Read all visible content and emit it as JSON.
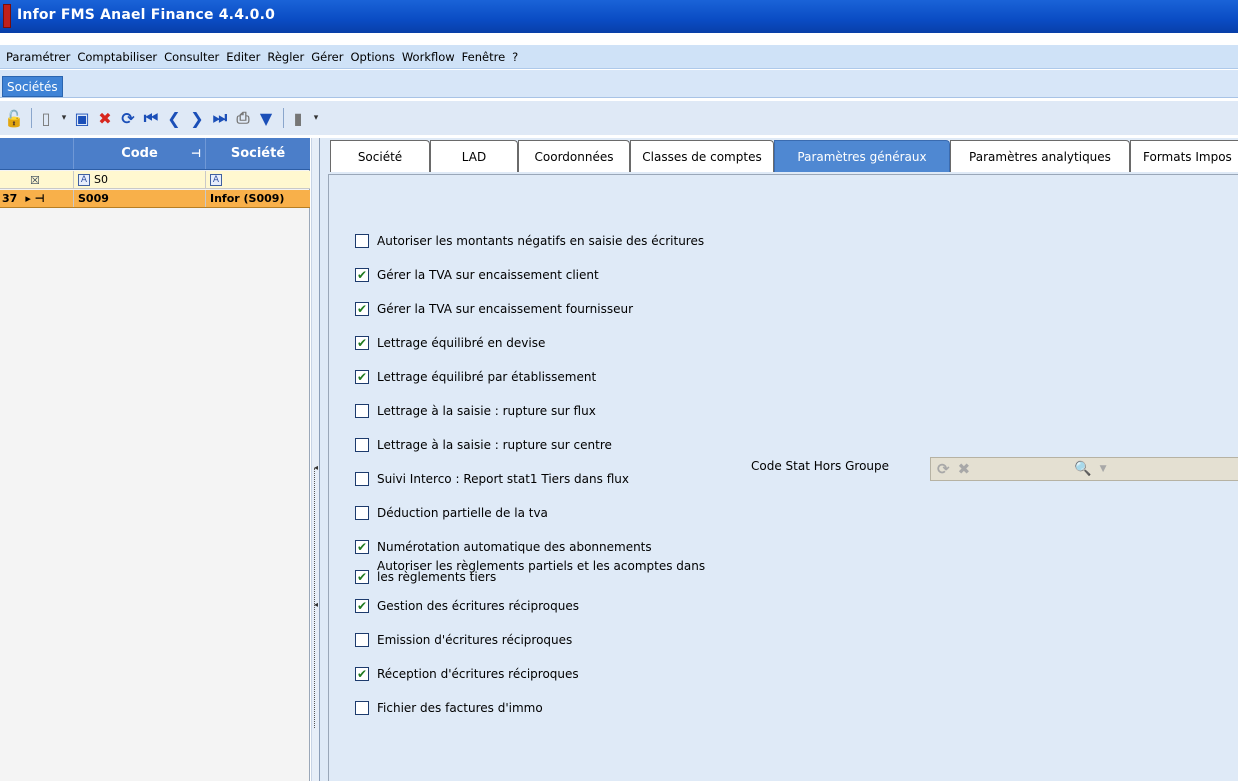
{
  "window": {
    "title": "Infor FMS Anael Finance 4.4.0.0"
  },
  "menubar": [
    "Paramétrer",
    "Comptabiliser",
    "Consulter",
    "Editer",
    "Règler",
    "Gérer",
    "Options",
    "Workflow",
    "Fenêtre",
    "?"
  ],
  "doc_tab": "Sociétés",
  "grid": {
    "columns": [
      "Code",
      "Société"
    ],
    "filter": {
      "code": "S0",
      "societe": ""
    },
    "row": {
      "count": "37",
      "code": "S009",
      "societe": "Infor (S009)"
    }
  },
  "tabs": [
    "Société",
    "LAD",
    "Coordonnées",
    "Classes de comptes",
    "Paramètres généraux",
    "Paramètres analytiques",
    "Formats Impos"
  ],
  "active_tab": "Paramètres généraux",
  "options": [
    {
      "label": "Autoriser les montants négatifs en saisie des écritures",
      "checked": false
    },
    {
      "label": "Gérer la TVA sur encaissement client",
      "checked": true
    },
    {
      "label": "Gérer la TVA sur encaissement fournisseur",
      "checked": true
    },
    {
      "label": "Lettrage équilibré en devise",
      "checked": true
    },
    {
      "label": "Lettrage équilibré par établissement",
      "checked": true
    },
    {
      "label": "Lettrage à la saisie : rupture sur flux",
      "checked": false
    },
    {
      "label": "Lettrage à la saisie : rupture sur centre",
      "checked": false
    },
    {
      "label": "Suivi Interco : Report stat1 Tiers dans flux",
      "checked": false
    },
    {
      "label": "Déduction partielle de la tva",
      "checked": false
    },
    {
      "label": "Numérotation automatique des abonnements",
      "checked": true
    },
    {
      "label_line1": "Autoriser les règlements partiels et les acomptes dans",
      "label_line2": "les règlements tiers",
      "checked": true
    },
    {
      "label": "Gestion des écritures réciproques",
      "checked": true
    },
    {
      "label": "Emission d'écritures réciproques",
      "checked": false
    },
    {
      "label": "Réception d'écritures réciproques",
      "checked": true
    },
    {
      "label": "Fichier des factures d'immo",
      "checked": false
    }
  ],
  "code_stat": {
    "label": "Code Stat Hors Groupe",
    "value": ""
  }
}
